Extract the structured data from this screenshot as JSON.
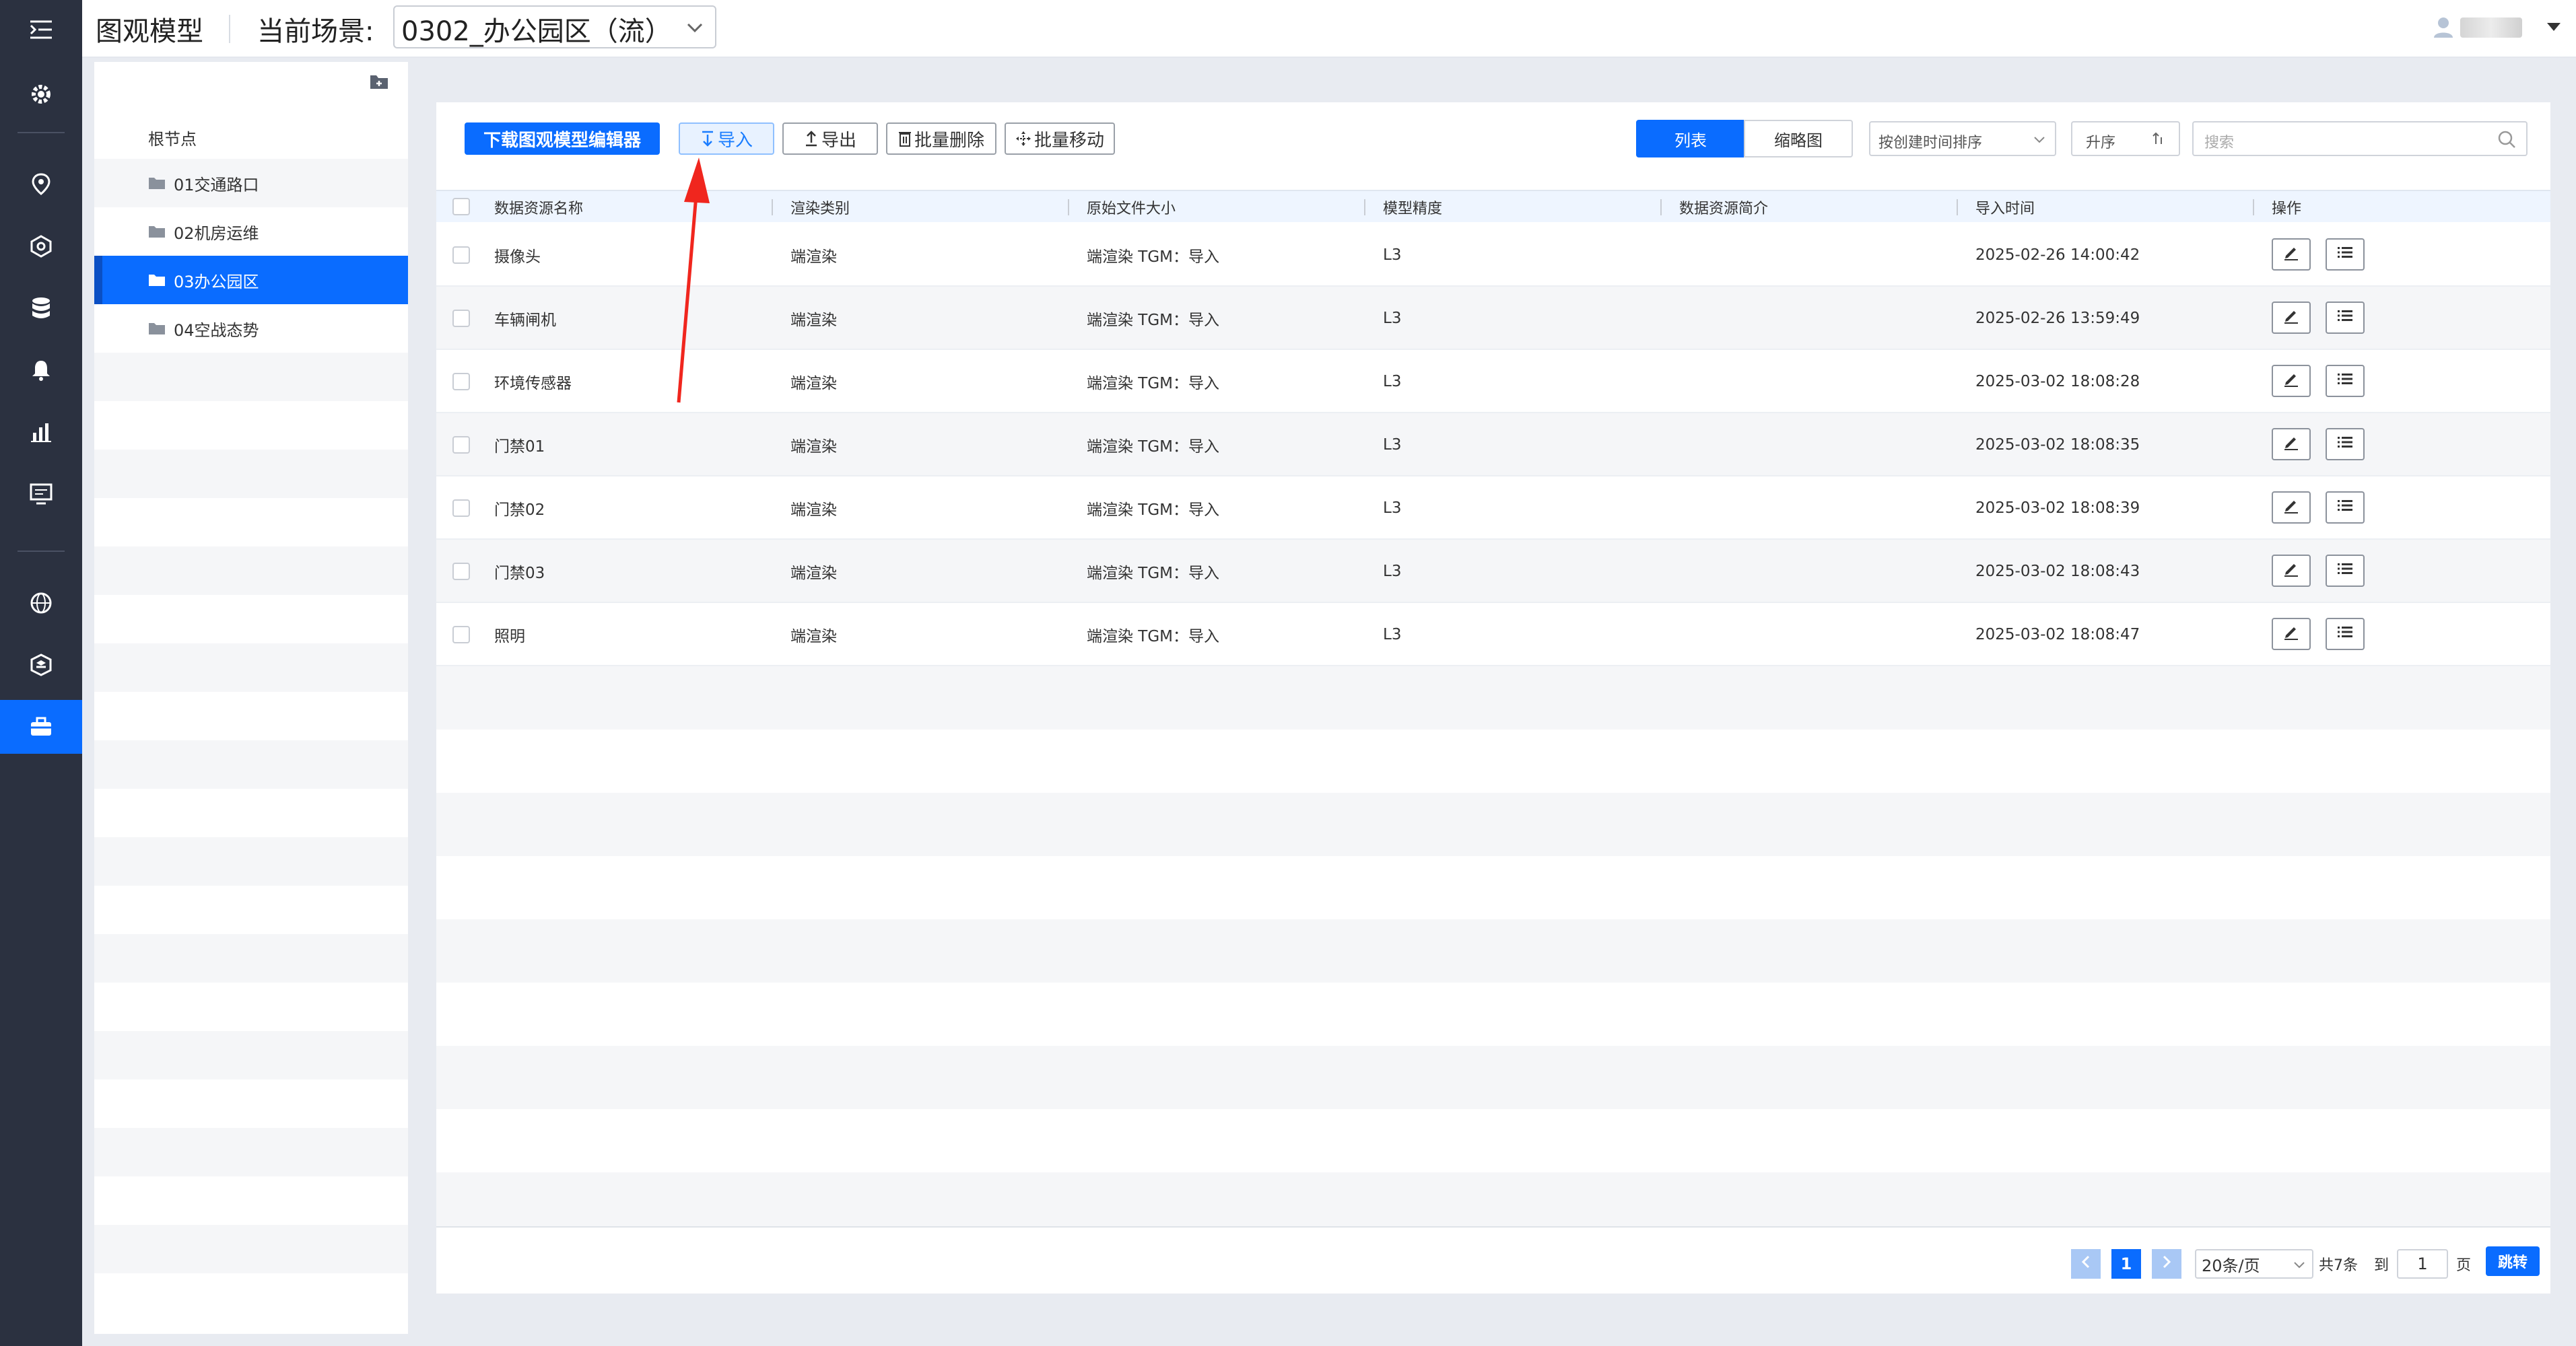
{
  "header": {
    "app_title": "图观模型",
    "scene_label": "当前场景:",
    "scene_value": "0302_办公园区（流）"
  },
  "rail": {
    "icons": [
      "menu-toggle-icon",
      "gear-icon",
      "map-pin-icon",
      "cube-settings-icon",
      "database-icon",
      "bell-icon",
      "bar-chart-icon",
      "monitor-icon",
      "globe-icon",
      "layers-icon",
      "model-box-icon"
    ],
    "active": "model-box-icon"
  },
  "tree": {
    "root": "根节点",
    "nodes": [
      "01交通路口",
      "02机房运维",
      "03办公园区",
      "04空战态势"
    ],
    "selected": "03办公园区"
  },
  "toolbar": {
    "download_editor": "下载图观模型编辑器",
    "import": "导入",
    "export": "导出",
    "batch_delete": "批量删除",
    "batch_move": "批量移动",
    "view_list": "列表",
    "view_thumb": "缩略图",
    "sort_by": "按创建时间排序",
    "sort_order": "升序",
    "search_placeholder": "搜索"
  },
  "table": {
    "columns": [
      "数据资源名称",
      "渲染类别",
      "原始文件大小",
      "模型精度",
      "数据资源简介",
      "导入时间",
      "操作"
    ],
    "rows": [
      {
        "name": "摄像头",
        "render": "端渲染",
        "size": "端渲染 TGM：导入",
        "precision": "L3",
        "desc": "",
        "time": "2025-02-26 14:00:42"
      },
      {
        "name": "车辆闸机",
        "render": "端渲染",
        "size": "端渲染 TGM：导入",
        "precision": "L3",
        "desc": "",
        "time": "2025-02-26 13:59:49"
      },
      {
        "name": "环境传感器",
        "render": "端渲染",
        "size": "端渲染 TGM：导入",
        "precision": "L3",
        "desc": "",
        "time": "2025-03-02 18:08:28"
      },
      {
        "name": "门禁01",
        "render": "端渲染",
        "size": "端渲染 TGM：导入",
        "precision": "L3",
        "desc": "",
        "time": "2025-03-02 18:08:35"
      },
      {
        "name": "门禁02",
        "render": "端渲染",
        "size": "端渲染 TGM：导入",
        "precision": "L3",
        "desc": "",
        "time": "2025-03-02 18:08:39"
      },
      {
        "name": "门禁03",
        "render": "端渲染",
        "size": "端渲染 TGM：导入",
        "precision": "L3",
        "desc": "",
        "time": "2025-03-02 18:08:43"
      },
      {
        "name": "照明",
        "render": "端渲染",
        "size": "端渲染 TGM：导入",
        "precision": "L3",
        "desc": "",
        "time": "2025-03-02 18:08:47"
      }
    ]
  },
  "pagination": {
    "current_page": "1",
    "page_size": "20条/页",
    "total": "共7条",
    "goto_label": "到",
    "goto_value": "1",
    "page_unit": "页",
    "go_button": "跳转"
  },
  "colors": {
    "accent": "#0a6cff",
    "rail_bg": "#2b3140",
    "annotation_arrow": "#f0261e"
  }
}
